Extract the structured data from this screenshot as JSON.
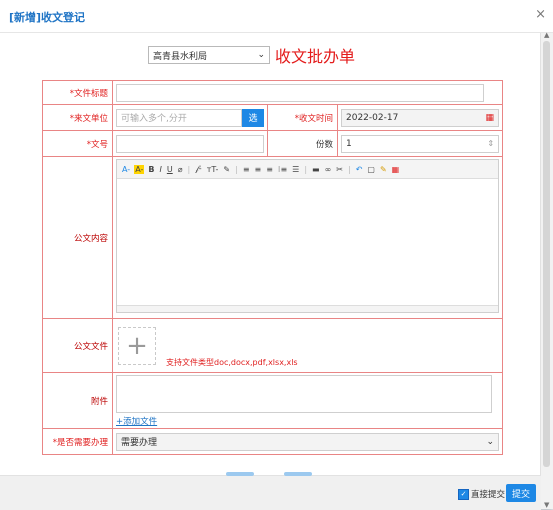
{
  "dialog": {
    "title": "[新增]收文登记",
    "close_icon": "×"
  },
  "header": {
    "department_selected": "高青县水利局",
    "form_title": "收文批办单"
  },
  "fields": {
    "doc_title_label": "*文件标题",
    "doc_title_value": "",
    "source_unit_label": "*来文单位",
    "source_unit_placeholder": "可输入多个,分开",
    "select_button": "选",
    "receive_time_label": "*收文时间",
    "receive_time_value": "2022-02-17",
    "doc_no_label": "*文号",
    "doc_no_value": "",
    "copies_label": "份数",
    "copies_value": "1",
    "content_label": "公文内容",
    "file_label": "公文文件",
    "file_support_text": "支持文件类型doc,docx,pdf,xlsx,xls",
    "attachment_label": "附件",
    "add_file_link": "+添加文件",
    "need_handle_label": "*是否需要办理",
    "need_handle_value": "需要办理"
  },
  "editor_toolbar": [
    "A-",
    "A-",
    "B",
    "I",
    "U",
    "⌀",
    "𝒻-",
    "тT-",
    "✎",
    "≡",
    "≡",
    "≡",
    "⁝≡",
    "☰",
    "▬",
    "∞",
    "✂",
    "↶",
    "▢",
    "✎",
    "▦"
  ],
  "footer": {
    "direct_submit_label": "直接提交",
    "direct_submit_checked": true,
    "submit_button": "提交"
  },
  "colors": {
    "accent": "#1e88e5",
    "required_label": "#e02020",
    "border": "#e98585"
  }
}
